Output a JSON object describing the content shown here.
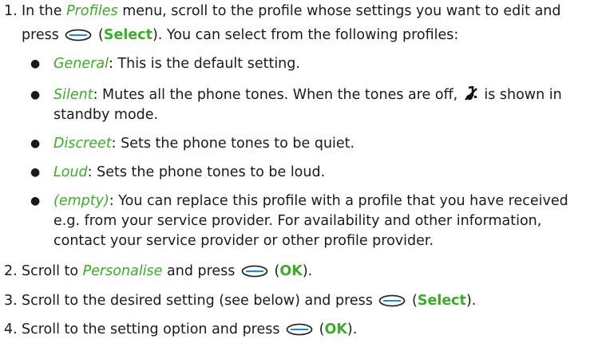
{
  "items": [
    {
      "number": "1.",
      "line1_a": "In the ",
      "term": "Profiles",
      "line1_b": " menu, scroll to the profile whose settings you want to edit and",
      "line2_a": "press ",
      "key": "Select",
      "line2_b": "). You can select from the following profiles:"
    },
    {
      "number": "2.",
      "text_a": "Scroll to ",
      "term": "Personalise",
      "text_b": " and press ",
      "key": "OK"
    },
    {
      "number": "3.",
      "text_a": "Scroll to the desired setting (see below) and press ",
      "key": "Select"
    },
    {
      "number": "4.",
      "text_a": "Scroll to the setting option and press ",
      "key": "OK"
    }
  ],
  "profiles": [
    {
      "name": "General",
      "desc": ": This is the default setting."
    },
    {
      "name": "Silent",
      "desc_a": ": Mutes all the phone tones. When the tones are off, ",
      "desc_b": " is shown in",
      "desc_line2": "standby mode."
    },
    {
      "name": "Discreet",
      "desc": ": Sets the phone tones to be quiet."
    },
    {
      "name": "Loud",
      "desc": ": Sets the phone tones to be loud."
    },
    {
      "name": "(empty)",
      "desc": ": You can replace this profile with a profile that you have received",
      "desc_line2": "e.g. from your service provider. For availability and other information,",
      "desc_line3": "contact your service provider or other profile provider."
    }
  ],
  "punct": {
    "open_paren": " (",
    "close_paren": ")",
    "close_paren_dot": ")."
  },
  "icons": {
    "select_key": "selection-key-icon",
    "silent": "silent-profile-icon"
  },
  "colors": {
    "term": "#3cab2a",
    "key_icon_stroke": "#2a2a2a",
    "key_icon_line": "#1e88d6"
  }
}
